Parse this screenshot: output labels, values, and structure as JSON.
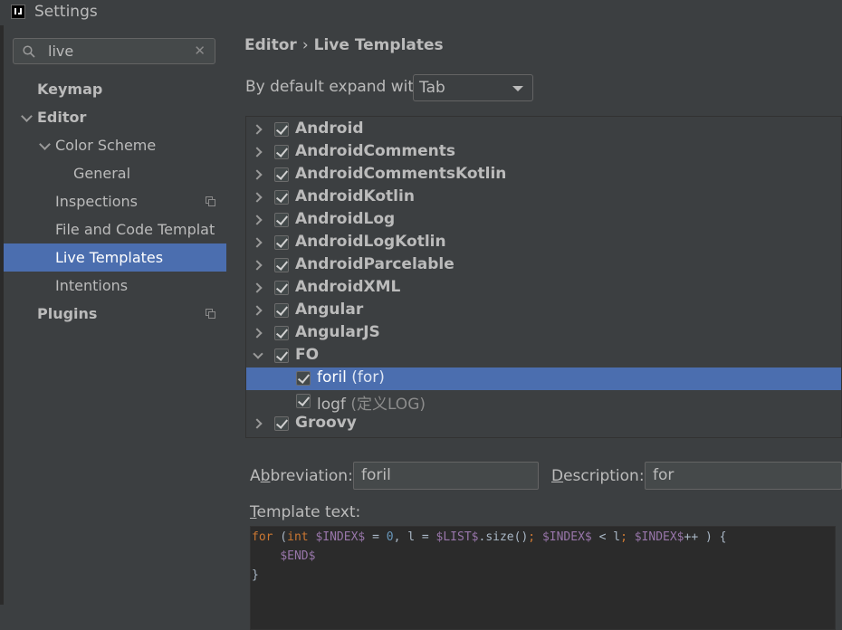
{
  "window": {
    "title": "Settings"
  },
  "search": {
    "value": "live"
  },
  "sidebar": {
    "items": [
      {
        "label": "Keymap"
      },
      {
        "label": "Editor"
      },
      {
        "label": "Color Scheme"
      },
      {
        "label": "General"
      },
      {
        "label": "Inspections"
      },
      {
        "label": "File and Code Templates"
      },
      {
        "label": "Live Templates"
      },
      {
        "label": "Intentions"
      },
      {
        "label": "Plugins"
      }
    ]
  },
  "breadcrumb": {
    "parent": "Editor",
    "separator": "›",
    "current": "Live Templates"
  },
  "expand": {
    "label": "By default expand with",
    "value": "Tab"
  },
  "tree": {
    "rows": [
      {
        "label": "Android",
        "checked": true,
        "expanded": false
      },
      {
        "label": "AndroidComments",
        "checked": true,
        "expanded": false
      },
      {
        "label": "AndroidCommentsKotlin",
        "checked": true,
        "expanded": false
      },
      {
        "label": "AndroidKotlin",
        "checked": true,
        "expanded": false
      },
      {
        "label": "AndroidLog",
        "checked": true,
        "expanded": false
      },
      {
        "label": "AndroidLogKotlin",
        "checked": true,
        "expanded": false
      },
      {
        "label": "AndroidParcelable",
        "checked": true,
        "expanded": false
      },
      {
        "label": "AndroidXML",
        "checked": true,
        "expanded": false
      },
      {
        "label": "Angular",
        "checked": true,
        "expanded": false
      },
      {
        "label": "AngularJS",
        "checked": true,
        "expanded": false
      },
      {
        "label": "FO",
        "checked": true,
        "expanded": true
      },
      {
        "label": "foril",
        "description": "(for)",
        "checked": true,
        "selected": true
      },
      {
        "label": "logf",
        "description": "(定义LOG)",
        "checked": true
      },
      {
        "label": "Groovy",
        "checked": true,
        "expanded": false
      }
    ]
  },
  "abbreviation": {
    "label_pre": "A",
    "label_mnemonic": "b",
    "label_post": "breviation:",
    "value": "foril"
  },
  "description": {
    "label_mnemonic": "D",
    "label_post": "escription:",
    "value": "for"
  },
  "template_text": {
    "label_mnemonic": "T",
    "label_post": "emplate text:",
    "line1": {
      "kw_for": "for",
      "p1": " (",
      "kw_int": "int",
      "p2": " ",
      "v_index1": "$INDEX$",
      "p3": " = ",
      "n_zero": "0",
      "p4": ", l = ",
      "v_list": "$LIST$",
      "p5": ".size()",
      "semi1": ";",
      "p6": " ",
      "v_index2": "$INDEX$",
      "p7": " < l",
      "semi2": ";",
      "p8": " ",
      "v_index3": "$INDEX$",
      "p9": "++ ) {"
    },
    "line2": {
      "indent": "    ",
      "v_end": "$END$"
    },
    "line3": "}"
  },
  "colors": {
    "selection": "#4b6eaf",
    "background": "#3c3f41",
    "editor_bg": "#2b2b2b"
  }
}
